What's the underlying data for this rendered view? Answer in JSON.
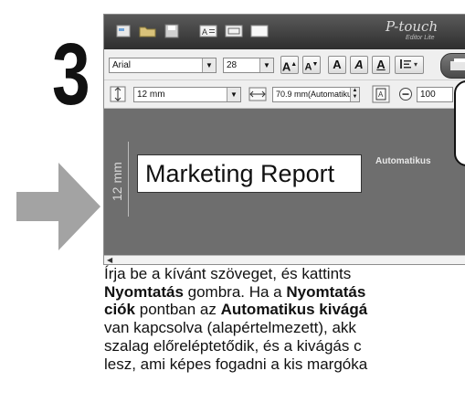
{
  "step": {
    "number": "3"
  },
  "app": {
    "logo_text": "P-touch",
    "logo_sub": "Editor Lite"
  },
  "toolbar": {
    "font_name": "Arial",
    "font_size": "28",
    "tape_width": "12 mm",
    "length_value": "70.9 mm(Automatiku",
    "zoom_value": "100",
    "btn_bigger_a": "A",
    "btn_smaller_a": "A",
    "btn_bold": "A",
    "btn_italic": "A",
    "btn_underline": "A"
  },
  "canvas": {
    "ruler_label": "12 mm",
    "label_text": "Marketing Report",
    "length_tag": "Automatikus"
  },
  "instructions": {
    "line1": "Írja be a kívánt szöveget, és kattints",
    "line2_bold1": "Nyomtatás",
    "line2_rest": " gombra. Ha a ",
    "line2_bold2": "Nyomtatás",
    "line3_bold1": "ciók",
    "line3_rest": " pontban az ",
    "line3_bold2": "Automatikus kivágá",
    "line4": "van kapcsolva (alapértelmezett), akk",
    "line5": "szalag előreléptetődik, és a kivágás c",
    "line6": "lesz, ami képes fogadni a kis margóka"
  },
  "colors": {
    "arrow": "#a3a3a3",
    "titlebar": "#3c3c3c",
    "canvas": "#6e6e6e"
  }
}
